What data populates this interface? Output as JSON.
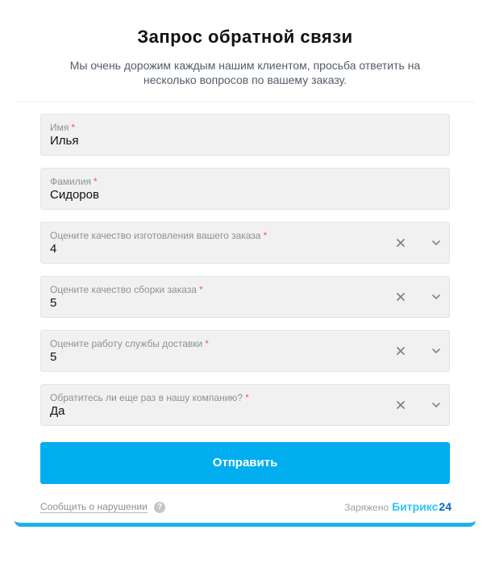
{
  "form": {
    "title": "Запрос обратной связи",
    "subtitle": "Мы очень дорожим каждым нашим клиентом, просьба ответить на несколько вопросов по вашему заказу.",
    "fields": [
      {
        "label": "Имя",
        "required_mark": "*",
        "value": "Илья",
        "type": "text"
      },
      {
        "label": "Фамилия",
        "required_mark": "*",
        "value": "Сидоров",
        "type": "text"
      },
      {
        "label": "Оцените качество изготовления вашего заказа",
        "required_mark": "*",
        "value": "4",
        "type": "select"
      },
      {
        "label": "Оцените качество сборки заказа",
        "required_mark": "*",
        "value": "5",
        "type": "select"
      },
      {
        "label": "Оцените работу службы доставки",
        "required_mark": "*",
        "value": "5",
        "type": "select"
      },
      {
        "label": "Обратитесь ли еще раз в нашу компанию?",
        "required_mark": "*",
        "value": "Да",
        "type": "select"
      }
    ],
    "submit_label": "Отправить"
  },
  "footer": {
    "report_label": "Сообщить о нарушении",
    "help_glyph": "?",
    "powered_label": "Заряжено",
    "brand_part1": "Битрикс",
    "brand_part2": "24"
  },
  "icons": {
    "clear": "close-icon",
    "dropdown": "chevron-down-icon",
    "help": "question-icon"
  },
  "colors": {
    "accent": "#00aeef",
    "required": "#f05c5c",
    "field_bg": "#f1f1f1",
    "brand_light": "#2fc6f6",
    "brand_dark": "#0b66c3"
  }
}
